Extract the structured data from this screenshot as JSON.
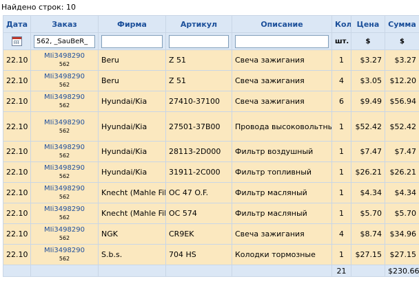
{
  "summary": {
    "found_label": "Найдено строк: 10"
  },
  "columns": {
    "date": "Дата",
    "order": "Заказ",
    "firm": "Фирма",
    "article": "Артикул",
    "description": "Описание",
    "qty": "Кол",
    "price": "Цена",
    "sum": "Сумма"
  },
  "subheaders": {
    "qty_unit": "шт.",
    "price_unit": "$",
    "sum_unit": "$"
  },
  "filters": {
    "order_value": "562, _SauBeR_",
    "firm_value": "",
    "article_value": "",
    "description_value": ""
  },
  "rows": [
    {
      "date": "22.10",
      "order": "MIi3498290",
      "order_sub": "562",
      "firm": "Beru",
      "article": "Z 51",
      "description": "Свеча зажигания",
      "qty": "1",
      "price": "$3.27",
      "sum": "$3.27"
    },
    {
      "date": "22.10",
      "order": "MIi3498290",
      "order_sub": "562",
      "firm": "Beru",
      "article": "Z 51",
      "description": "Свеча зажигания",
      "qty": "4",
      "price": "$3.05",
      "sum": "$12.20"
    },
    {
      "date": "22.10",
      "order": "MIi3498290",
      "order_sub": "562",
      "firm": "Hyundai/Kia",
      "article": "27410-37100",
      "description": "Свеча зажигания",
      "qty": "6",
      "price": "$9.49",
      "sum": "$56.94"
    },
    {
      "date": "22.10",
      "order": "MIi3498290",
      "order_sub": "562",
      "firm": "Hyundai/Kia",
      "article": "27501-37B00",
      "description": "Провода высоковольтные, комплект",
      "qty": "1",
      "price": "$52.42",
      "sum": "$52.42"
    },
    {
      "date": "22.10",
      "order": "MIi3498290",
      "order_sub": "562",
      "firm": "Hyundai/Kia",
      "article": "28113-2D000",
      "description": "Фильтр воздушный",
      "qty": "1",
      "price": "$7.47",
      "sum": "$7.47"
    },
    {
      "date": "22.10",
      "order": "MIi3498290",
      "order_sub": "562",
      "firm": "Hyundai/Kia",
      "article": "31911-2C000",
      "description": "Фильтр топливный",
      "qty": "1",
      "price": "$26.21",
      "sum": "$26.21"
    },
    {
      "date": "22.10",
      "order": "MIi3498290",
      "order_sub": "562",
      "firm": "Knecht (Mahle Filter)",
      "article": "OC 47 O.F.",
      "description": "Фильтр масляный",
      "qty": "1",
      "price": "$4.34",
      "sum": "$4.34"
    },
    {
      "date": "22.10",
      "order": "MIi3498290",
      "order_sub": "562",
      "firm": "Knecht (Mahle Filter)",
      "article": "OC 574",
      "description": "Фильтр масляный",
      "qty": "1",
      "price": "$5.70",
      "sum": "$5.70"
    },
    {
      "date": "22.10",
      "order": "MIi3498290",
      "order_sub": "562",
      "firm": "NGK",
      "article": "CR9EK",
      "description": "Свеча зажигания",
      "qty": "4",
      "price": "$8.74",
      "sum": "$34.96"
    },
    {
      "date": "22.10",
      "order": "MIi3498290",
      "order_sub": "562",
      "firm": "S.b.s.",
      "article": "704 HS",
      "description": "Колодки тормозные",
      "qty": "1",
      "price": "$27.15",
      "sum": "$27.15"
    }
  ],
  "totals": {
    "qty": "21",
    "sum": "$230.66"
  },
  "icons": {
    "date_filter": "calendar-icon"
  },
  "colors": {
    "header_bg": "#dbe7f5",
    "header_text": "#1b4f9a",
    "row_bg": "#fbe8bf",
    "link": "#1f4f9c"
  }
}
